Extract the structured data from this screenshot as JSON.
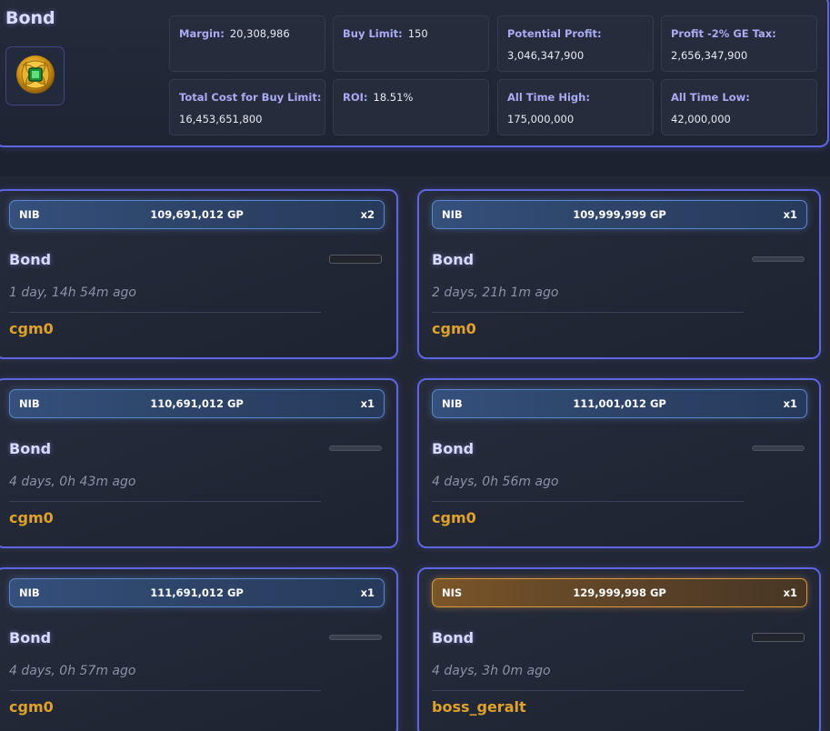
{
  "header": {
    "title": "Bond",
    "icon": "bond-icon",
    "stats": {
      "margin_label": "Margin:",
      "margin_value": "20,308,986",
      "buy_limit_label": "Buy Limit:",
      "buy_limit_value": "150",
      "potential_profit_label": "Potential Profit:",
      "potential_profit_value": "3,046,347,900",
      "profit_tax_label": "Profit -2% GE Tax:",
      "profit_tax_value": "2,656,347,900",
      "total_cost_label": "Total Cost for Buy Limit:",
      "total_cost_value": "16,453,651,800",
      "roi_label": "ROI:",
      "roi_value": "18.51%",
      "ath_label": "All Time High:",
      "ath_value": "175,000,000",
      "atl_label": "All Time Low:",
      "atl_value": "42,000,000"
    }
  },
  "colors": {
    "accent_border": "#5d66e0",
    "buy_bar": "#34507c",
    "sell_bar": "#7a5528",
    "username": "#e0a22a"
  },
  "offers": [
    {
      "type": "NIB",
      "price": "109,691,012 GP",
      "qty": "x2",
      "item": "Bond",
      "time": "1 day, 14h 54m ago",
      "user": "cgm0"
    },
    {
      "type": "NIB",
      "price": "109,999,999 GP",
      "qty": "x1",
      "item": "Bond",
      "time": "2 days, 21h 1m ago",
      "user": "cgm0"
    },
    {
      "type": "NIB",
      "price": "110,691,012 GP",
      "qty": "x1",
      "item": "Bond",
      "time": "4 days, 0h 43m ago",
      "user": "cgm0"
    },
    {
      "type": "NIB",
      "price": "111,001,012 GP",
      "qty": "x1",
      "item": "Bond",
      "time": "4 days, 0h 56m ago",
      "user": "cgm0"
    },
    {
      "type": "NIB",
      "price": "111,691,012 GP",
      "qty": "x1",
      "item": "Bond",
      "time": "4 days, 0h 57m ago",
      "user": "cgm0"
    },
    {
      "type": "NIS",
      "price": "129,999,998 GP",
      "qty": "x1",
      "item": "Bond",
      "time": "4 days, 3h 0m ago",
      "user": "boss_geralt"
    }
  ]
}
